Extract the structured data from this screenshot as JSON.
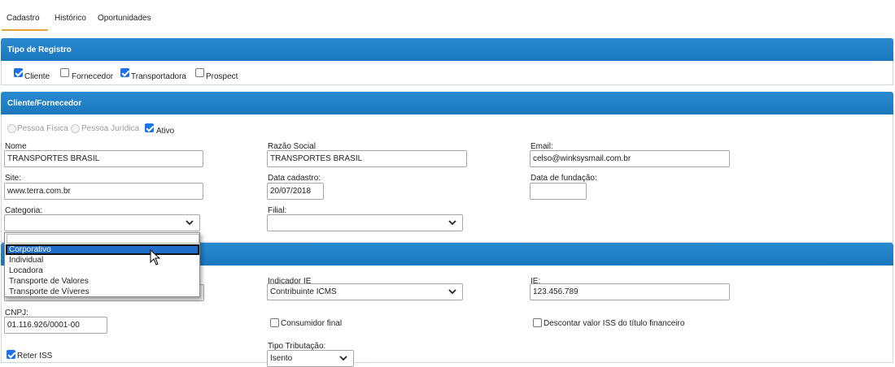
{
  "tabs": [
    "Cadastro",
    "Histórico",
    "Oportunidades"
  ],
  "tipo_registro": {
    "title": "Tipo de Registro",
    "options": [
      {
        "label": "Cliente",
        "checked": true
      },
      {
        "label": "Fornecedor",
        "checked": false
      },
      {
        "label": "Transportadora",
        "checked": true
      },
      {
        "label": "Prospect",
        "checked": false
      }
    ]
  },
  "cliente": {
    "title": "Cliente/Fornecedor",
    "pessoa_fisica": "Pessoa Física",
    "pessoa_juridica": "Pessoa Jurídica",
    "ativo": "Ativo",
    "nome_label": "Nome",
    "nome_value": "TRANSPORTES BRASIL",
    "razao_label": "Razão Social",
    "razao_value": "TRANSPORTES BRASIL",
    "email_label": "Email:",
    "email_value": "celso@winksysmail.com.br",
    "site_label": "Site:",
    "site_value": "www.terra.com.br",
    "data_cadastro_label": "Data cadastro:",
    "data_cadastro_value": "20/07/2018",
    "data_fundacao_label": "Data de fundação:",
    "data_fundacao_value": "",
    "categoria_label": "Categoria:",
    "categoria_value": "",
    "filial_label": "Filial:",
    "filial_value": ""
  },
  "categoria_dropdown": {
    "options": [
      "Corporativo",
      "Individual",
      "Locadora",
      "Transporte de Valores",
      "Transporte de Víveres"
    ],
    "highlighted": "Corporativo"
  },
  "fiscal": {
    "indicador_label": "Indicador IE",
    "indicador_value": "Contribuinte ICMS",
    "ie_label": "IE:",
    "ie_value": "123.456.789",
    "cnpj_label": "CNPJ:",
    "cnpj_value": "01.116.926/0001-00",
    "consumidor_final": "Consumidor final",
    "descontar_iss": "Descontar valor ISS do título financeiro",
    "reter_iss": "Reter ISS",
    "tipo_tributacao_label": "Tipo Tributação:",
    "tipo_tributacao_value": "Isento"
  },
  "colors": {
    "header": "#1a77be",
    "tab_accent": "#e8a33a",
    "selection": "#1f6fc9"
  }
}
